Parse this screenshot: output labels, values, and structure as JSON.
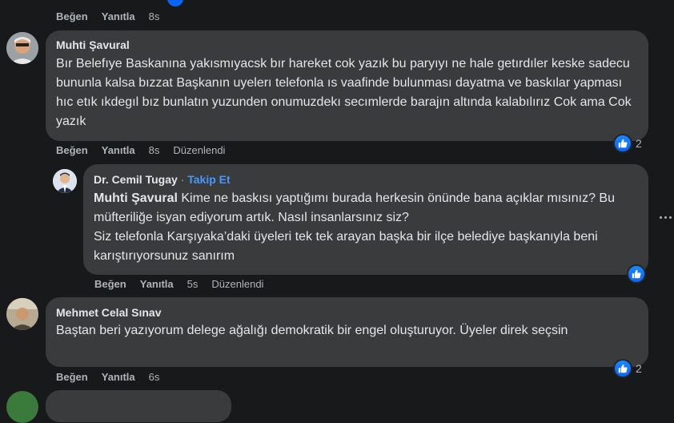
{
  "top_actions": {
    "like": "Beğen",
    "reply": "Yanıtla",
    "time": "8s"
  },
  "comments": [
    {
      "author": "Muhti Şavural",
      "text": "Bır Belefıye Baskanına yakısmıyacsk bır hareket cok yazık bu paryıyı ne hale getırdıler keske sadecu bununla kalsa bızzat Başkanın uyelerı telefonla ıs vaafinde bulunması dayatma ve baskılar yapması hıc etık ıkdegıl bız bunlatın yuzunden onumuzdekı secımlerde barajın altında kalabılırız Cok ama Cok yazık",
      "like": "Beğen",
      "reply": "Yanıtla",
      "time": "8s",
      "edited": "Düzenlendi",
      "reaction_count": "2"
    },
    {
      "author": "Dr. Cemil Tugay",
      "separator": "·",
      "follow": "Takip Et",
      "mention": "Muhti Şavural",
      "text": " Kime ne baskısı yaptığımı burada herkesin önünde bana açıklar mısınız? Bu müfteriliğe isyan ediyorum artık. Nasıl insanlarsınız siz?",
      "text2": "Siz telefonla Karşıyaka’daki üyeleri tek tek arayan başka bir ilçe belediye başkanıyla beni karıştırıyorsunuz sanırım",
      "like": "Beğen",
      "reply": "Yanıtla",
      "time": "5s",
      "edited": "Düzenlendi"
    },
    {
      "author": "Mehmet Celal Sınav",
      "text": "Baştan beri yazıyorum delege ağalığı demokratik bir engel oluşturuyor. Üyeler direk seçsin",
      "like": "Beğen",
      "reply": "Yanıtla",
      "time": "6s",
      "reaction_count": "2"
    }
  ],
  "icons": {
    "like_reaction": "thumbs-up-icon",
    "more": "more-options-icon"
  },
  "colors": {
    "background": "#18191a",
    "bubble": "#3a3b3c",
    "link": "#4599ff",
    "like": "#0866ff"
  }
}
